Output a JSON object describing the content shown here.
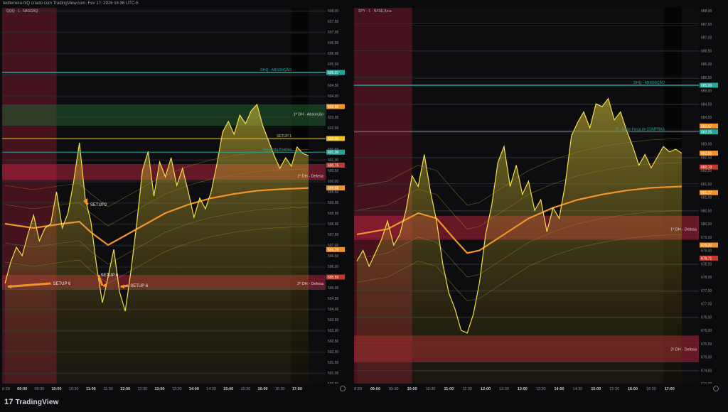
{
  "header": {
    "title": "leoferreira-NQ criado com TradingView.com, Fev 17, 2026 16:36 UTC-5"
  },
  "footer": {
    "brand": "TradingView",
    "brand_mark": "17"
  },
  "colors": {
    "price_line": "#f5e04a",
    "vwap": "#f0932b",
    "teal": "#26a69a",
    "absorcao_zone": "#1f5f2d",
    "defesa_zone": "#b3223a",
    "premarket": "#5a1424",
    "axis_text": "#8b8f95",
    "label_orange": "#f0932b",
    "label_red": "#c0392b"
  },
  "charts": [
    {
      "id": "qqq",
      "symbol_label": "QQQ · 1 · NASDAQ",
      "y_range": [
        590.5,
        608.0
      ],
      "y_ticks": [
        "590,50",
        "591,00",
        "591,50",
        "592,00",
        "592,50",
        "593,00",
        "593,50",
        "594,00",
        "594,50",
        "595,00",
        "595,50",
        "596,00",
        "596,50",
        "597,00",
        "597,50",
        "598,00",
        "598,50",
        "599,00",
        "599,50",
        "600,00",
        "600,50",
        "601,00",
        "601,50",
        "602,00",
        "602,50",
        "603,00",
        "603,50",
        "604,00",
        "604,50",
        "605,00",
        "605,50",
        "606,00",
        "606,50",
        "607,00",
        "607,50",
        "608,00"
      ],
      "x_ticks": [
        "08:30",
        "09:00",
        "09:30",
        "10:00",
        "10:30",
        "11:00",
        "11:30",
        "12:00",
        "12:30",
        "13:00",
        "13:30",
        "14:00",
        "14:30",
        "15:00",
        "15:30",
        "16:00",
        "16:30",
        "17:00"
      ],
      "bold_x_ticks": [
        "09:00",
        "10:00",
        "11:00",
        "12:00",
        "13:00",
        "14:00",
        "15:00",
        "16:00",
        "17:00"
      ],
      "zones": [
        {
          "name": "absorcao",
          "from": 602.6,
          "to": 603.6,
          "color": "#1f5f2d"
        },
        {
          "name": "defesa-1",
          "from": 600.05,
          "to": 600.8,
          "color": "#b3223a"
        },
        {
          "name": "defesa-2",
          "from": 594.9,
          "to": 595.6,
          "color": "#b3223a"
        }
      ],
      "levels": [
        {
          "name": "dhq-absorcao",
          "value": 605.1,
          "color": "#26a69a",
          "width": 1.4,
          "text": "DHQ - ABSORÇÃO",
          "badge": "605,07"
        },
        {
          "name": "setup-1",
          "value": 602.0,
          "color": "#f0c020",
          "width": 1,
          "text": "SETUP 1",
          "badge": "602,00"
        },
        {
          "name": "if-line",
          "value": 601.36,
          "color": "#26a69a",
          "width": 1,
          "text": "Demanda Positiva",
          "badge": "601,36"
        }
      ],
      "zone_labels": [
        {
          "text": "1º DH - Absorção",
          "value": 603.15
        },
        {
          "text": "1º DH - Defesa",
          "value": 600.25
        },
        {
          "text": "2º DH - Defesa",
          "value": 595.2
        }
      ],
      "badges": [
        {
          "text": "603,50",
          "value": 603.5,
          "color": "#f0932b"
        },
        {
          "text": "600,75",
          "value": 600.75,
          "color": "#c0392b"
        },
        {
          "text": "599,68",
          "value": 599.68,
          "color": "#f0932b"
        },
        {
          "text": "596,79",
          "value": 596.79,
          "color": "#f0932b"
        },
        {
          "text": "595,50",
          "value": 595.5,
          "color": "#c0392b"
        }
      ],
      "annotations": [
        {
          "text": "SETUP 6",
          "arrow_from": [
            8.0,
            595.2
          ],
          "arrow_to": [
            0.5,
            595.05
          ]
        },
        {
          "text": "SETUP2",
          "arrow_from": [
            14.5,
            598.9
          ],
          "arrow_to": [
            13.8,
            599.1
          ]
        },
        {
          "text": "SETUP 6",
          "arrow_from": [
            16.3,
            595.6
          ],
          "arrow_to": [
            17.0,
            595.1
          ]
        },
        {
          "text": "SETUP 6",
          "arrow_from": [
            21.5,
            595.1
          ],
          "arrow_to": [
            20.2,
            595.05
          ]
        }
      ],
      "series_price": [
        [
          0,
          595.2
        ],
        [
          1,
          596.2
        ],
        [
          2,
          596.9
        ],
        [
          3,
          596.5
        ],
        [
          4,
          597.5
        ],
        [
          5,
          598.4
        ],
        [
          6,
          597.2
        ],
        [
          7,
          597.8
        ],
        [
          8,
          598.0
        ],
        [
          9,
          599.5
        ],
        [
          10,
          597.8
        ],
        [
          11,
          598.5
        ],
        [
          12,
          600.0
        ],
        [
          13,
          601.8
        ],
        [
          14,
          599.2
        ],
        [
          15,
          598.1
        ],
        [
          16,
          596.0
        ],
        [
          17,
          594.3
        ],
        [
          18,
          595.5
        ],
        [
          19,
          596.8
        ],
        [
          20,
          594.8
        ],
        [
          21,
          593.9
        ],
        [
          22,
          595.8
        ],
        [
          23,
          598.0
        ],
        [
          24,
          600.5
        ],
        [
          25,
          601.4
        ],
        [
          26,
          599.3
        ],
        [
          27,
          600.9
        ],
        [
          28,
          600.2
        ],
        [
          29,
          601.1
        ],
        [
          30,
          599.8
        ],
        [
          31,
          600.6
        ],
        [
          32,
          599.5
        ],
        [
          33,
          598.3
        ],
        [
          34,
          599.2
        ],
        [
          35,
          598.7
        ],
        [
          36,
          599.5
        ],
        [
          37,
          600.8
        ],
        [
          38,
          602.3
        ],
        [
          39,
          602.8
        ],
        [
          40,
          602.2
        ],
        [
          41,
          603.1
        ],
        [
          42,
          602.7
        ],
        [
          43,
          603.3
        ],
        [
          44,
          603.6
        ],
        [
          45,
          602.6
        ],
        [
          46,
          601.9
        ],
        [
          47,
          601.2
        ],
        [
          48,
          600.6
        ],
        [
          49,
          601.1
        ],
        [
          50,
          600.7
        ],
        [
          51,
          601.6
        ],
        [
          52,
          601.3
        ],
        [
          53,
          601.2
        ]
      ],
      "series_vwap": [
        [
          0,
          598.0
        ],
        [
          5,
          597.8
        ],
        [
          10,
          598.0
        ],
        [
          13,
          598.1
        ],
        [
          15,
          597.6
        ],
        [
          18,
          597.0
        ],
        [
          20,
          597.3
        ],
        [
          24,
          597.9
        ],
        [
          28,
          598.5
        ],
        [
          32,
          598.9
        ],
        [
          36,
          599.2
        ],
        [
          40,
          599.4
        ],
        [
          44,
          599.55
        ],
        [
          48,
          599.62
        ],
        [
          53,
          599.68
        ]
      ],
      "x_count": 54,
      "time_ticks_index": [
        0,
        3,
        6,
        9,
        12,
        15,
        18,
        21,
        24,
        27,
        30,
        33,
        36,
        39,
        42,
        45,
        48,
        51
      ],
      "premarket_end": 9,
      "after_start": 50
    },
    {
      "id": "spy",
      "symbol_label": "SPY · 1 · NYSE Arca",
      "y_range": [
        674.0,
        688.0
      ],
      "y_ticks": [
        "674,00",
        "674,50",
        "675,00",
        "675,50",
        "676,00",
        "676,50",
        "677,00",
        "677,50",
        "678,00",
        "678,50",
        "679,00",
        "679,50",
        "680,00",
        "680,50",
        "681,00",
        "681,50",
        "682,00",
        "682,50",
        "683,00",
        "683,50",
        "684,00",
        "684,50",
        "685,00",
        "685,50",
        "686,00",
        "686,50",
        "687,00",
        "687,50",
        "688,00"
      ],
      "x_ticks": [
        "08:30",
        "09:00",
        "09:30",
        "10:00",
        "10:30",
        "11:00",
        "11:30",
        "12:00",
        "12:30",
        "13:00",
        "13:30",
        "14:00",
        "14:30",
        "15:00",
        "15:30",
        "16:00",
        "16:30",
        "17:00"
      ],
      "bold_x_ticks": [
        "09:00",
        "10:00",
        "11:00",
        "12:00",
        "13:00",
        "14:00",
        "15:00",
        "16:00",
        "17:00"
      ],
      "zones": [
        {
          "name": "defesa-1",
          "from": 679.4,
          "to": 680.3,
          "color": "#b3223a"
        },
        {
          "name": "defesa-2",
          "from": 674.8,
          "to": 675.8,
          "color": "#b3223a"
        }
      ],
      "levels": [
        {
          "name": "dhq-absorcao",
          "value": 685.2,
          "color": "#26a69a",
          "width": 1.4,
          "text": "DHQ - ABSORÇÃO",
          "badge": "685,00"
        },
        {
          "name": "if-compras",
          "value": 683.45,
          "color": "#26a69a",
          "width": 1,
          "text": "IF - Maior Força de COMPRAS",
          "badge": "683,35"
        }
      ],
      "zone_labels": [
        {
          "text": "1º DH - Defesa",
          "value": 679.8
        },
        {
          "text": "2º DH - Defesa",
          "value": 675.3
        }
      ],
      "badges": [
        {
          "text": "683,67",
          "value": 683.67,
          "color": "#f0932b"
        },
        {
          "text": "682,65",
          "value": 682.65,
          "color": "#f0932b"
        },
        {
          "text": "682,13",
          "value": 682.13,
          "color": "#c0392b"
        },
        {
          "text": "681,17",
          "value": 681.17,
          "color": "#f0932b"
        },
        {
          "text": "679,20",
          "value": 679.2,
          "color": "#f0932b"
        },
        {
          "text": "678,71",
          "value": 678.71,
          "color": "#c0392b"
        }
      ],
      "annotations": [],
      "series_price": [
        [
          0,
          678.6
        ],
        [
          1,
          679.0
        ],
        [
          2,
          678.4
        ],
        [
          3,
          678.9
        ],
        [
          4,
          679.4
        ],
        [
          5,
          680.1
        ],
        [
          6,
          679.2
        ],
        [
          7,
          679.6
        ],
        [
          8,
          680.5
        ],
        [
          9,
          681.8
        ],
        [
          10,
          681.4
        ],
        [
          11,
          682.6
        ],
        [
          12,
          681.2
        ],
        [
          13,
          680.1
        ],
        [
          14,
          678.5
        ],
        [
          15,
          677.4
        ],
        [
          16,
          676.8
        ],
        [
          17,
          676.0
        ],
        [
          18,
          675.9
        ],
        [
          19,
          676.6
        ],
        [
          20,
          677.8
        ],
        [
          21,
          679.6
        ],
        [
          22,
          680.7
        ],
        [
          23,
          682.3
        ],
        [
          24,
          682.9
        ],
        [
          25,
          681.4
        ],
        [
          26,
          682.2
        ],
        [
          27,
          681.1
        ],
        [
          28,
          681.6
        ],
        [
          29,
          680.5
        ],
        [
          30,
          680.9
        ],
        [
          31,
          679.7
        ],
        [
          32,
          680.6
        ],
        [
          33,
          680.2
        ],
        [
          34,
          681.5
        ],
        [
          35,
          683.3
        ],
        [
          36,
          683.8
        ],
        [
          37,
          684.2
        ],
        [
          38,
          683.6
        ],
        [
          39,
          684.5
        ],
        [
          40,
          684.4
        ],
        [
          41,
          684.7
        ],
        [
          42,
          683.9
        ],
        [
          43,
          684.2
        ],
        [
          44,
          683.5
        ],
        [
          45,
          682.9
        ],
        [
          46,
          682.2
        ],
        [
          47,
          682.6
        ],
        [
          48,
          682.1
        ],
        [
          49,
          682.5
        ],
        [
          50,
          682.9
        ],
        [
          51,
          682.7
        ],
        [
          52,
          682.8
        ],
        [
          53,
          682.65
        ]
      ],
      "series_vwap": [
        [
          0,
          679.6
        ],
        [
          5,
          679.8
        ],
        [
          10,
          680.4
        ],
        [
          13,
          680.2
        ],
        [
          16,
          679.4
        ],
        [
          18,
          678.9
        ],
        [
          20,
          679.0
        ],
        [
          24,
          679.6
        ],
        [
          28,
          680.2
        ],
        [
          32,
          680.6
        ],
        [
          36,
          680.9
        ],
        [
          40,
          681.1
        ],
        [
          44,
          681.25
        ],
        [
          48,
          681.35
        ],
        [
          53,
          681.4
        ]
      ],
      "x_count": 54,
      "time_ticks_index": [
        0,
        3,
        6,
        9,
        12,
        15,
        18,
        21,
        24,
        27,
        30,
        33,
        36,
        39,
        42,
        45,
        48,
        51
      ],
      "premarket_end": 9,
      "after_start": 50
    }
  ]
}
